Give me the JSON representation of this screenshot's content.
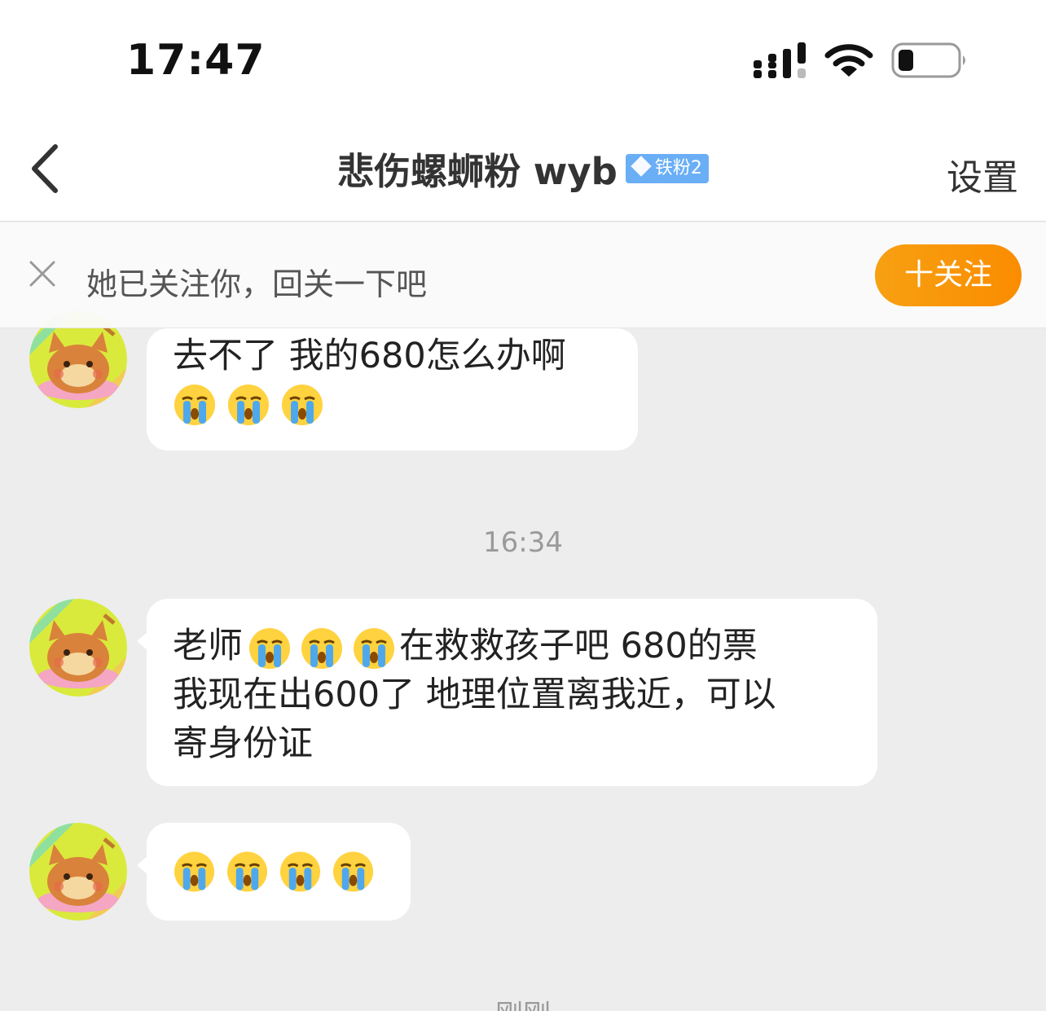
{
  "status_bar": {
    "time": "17:47"
  },
  "nav": {
    "title": "悲伤螺蛳粉 wyb",
    "badge": "铁粉2",
    "settings_label": "设置"
  },
  "follow_banner": {
    "text": "她已关注你，回关一下吧",
    "button_label": "十关注"
  },
  "messages": [
    {
      "text": "去不了 我的680怎么办啊",
      "emojis": [
        "crying-emoji",
        "crying-emoji",
        "crying-emoji"
      ]
    },
    {
      "line1_prefix": "老师",
      "emojis_inline": [
        "crying-emoji",
        "crying-emoji",
        "crying-emoji"
      ],
      "line1_suffix": "在救救孩子吧 680的票",
      "line2": "我现在出600了 地理位置离我近，可以",
      "line3": "寄身份证"
    },
    {
      "emojis": [
        "crying-emoji",
        "crying-emoji",
        "crying-emoji",
        "crying-emoji"
      ]
    }
  ],
  "timestamps": [
    "16:34",
    "刚刚"
  ],
  "colors": {
    "accent": "#fb8c00",
    "badge": "#6aaef5",
    "background": "#ededed",
    "bubble": "#ffffff"
  }
}
